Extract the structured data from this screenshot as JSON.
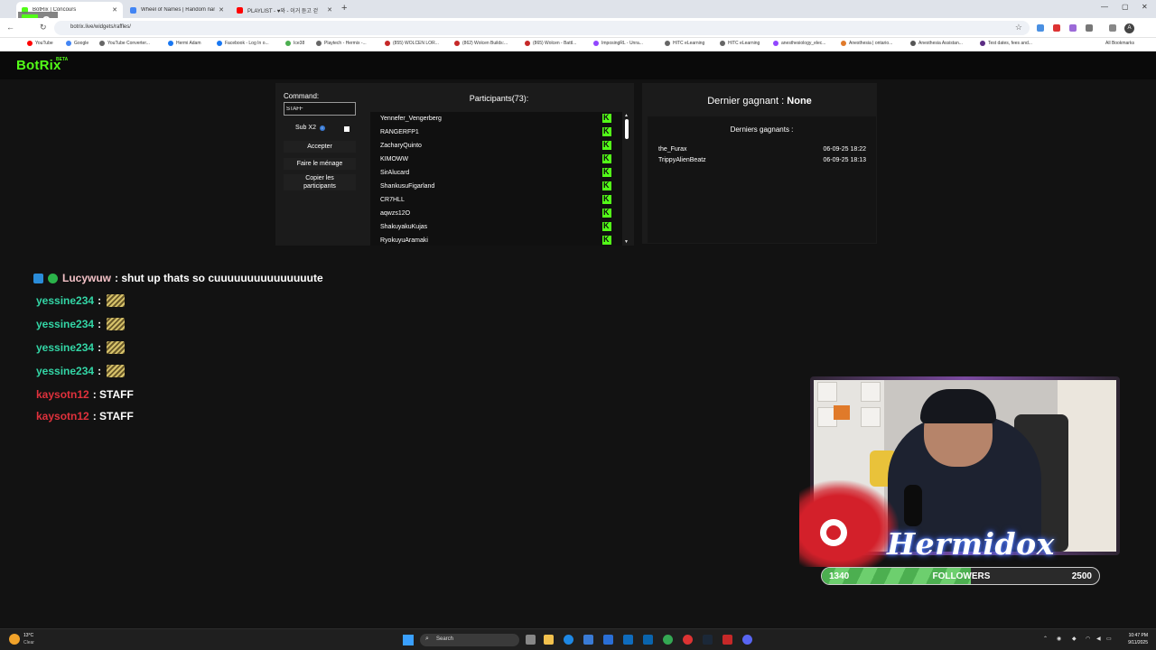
{
  "browser": {
    "tabs": [
      {
        "title": "BotRix | Concours",
        "active": true,
        "favicon_color": "#53fc18"
      },
      {
        "title": "Wheel of Names | Random nam",
        "active": false,
        "favicon_color": "#4285f4"
      },
      {
        "title": "PLAYLIST - ♥와 - 이거 듣고 걷",
        "active": false,
        "favicon_color": "#ff0000"
      }
    ],
    "new_tab": "+",
    "url": "botrix.live/widgets/raffles/",
    "bookmarks": [
      "YouTube",
      "Google",
      "YouTube Converter...",
      "Hermi Adam",
      "Facebook - Log In o...",
      "Ice38",
      "Playtech - Hermix -...",
      "(855) WOLCEN LOR...",
      "(862) Wolcen Builds:...",
      "(865) Wolcen - Battl...",
      "ImposingRL - Unra...",
      "HITC eLearning",
      "HITC eLearning",
      "anesthesiology_elec...",
      "Anesthesia | ontario...",
      "Anesthesia Assistan...",
      "Test dates, fees and..."
    ],
    "all_bookmarks": "All Bookmarks",
    "profile_initial": "A"
  },
  "overlay": {
    "counter": "9"
  },
  "app": {
    "logo": "BotRix",
    "beta": "BETA",
    "command_label": "Command:",
    "command_value": "STAFF",
    "sub_label": "Sub X2",
    "buttons": {
      "accept": "Accepter",
      "clean": "Faire le ménage",
      "copy": "Copier les participants"
    },
    "participants_title": "Participants(73):",
    "participants": [
      "Yennefer_Vengerberg",
      "RANGERFP1",
      "ZacharyQuinto",
      "KIMOWW",
      "SirAlucard",
      "ShankusuFigarland",
      "CR7HLL",
      "aqwzs12O",
      "ShakuyakuKujas",
      "RyokuyuAramaki"
    ],
    "last_winner_label": "Dernier gagnant :",
    "last_winner_value": "None",
    "recent_winners_title": "Derniers gagnants :",
    "recent_winners": [
      {
        "name": "the_Furax",
        "date": "06-09-25 18:22"
      },
      {
        "name": "TrippyAlienBeatz",
        "date": "06-09-25 18:13"
      }
    ]
  },
  "chat": [
    {
      "user": "Lucywuw",
      "color": "#f3c1c6",
      "text": ": shut up thats so cuuuuuuuuuuuuuuute",
      "emote": false,
      "badges": true
    },
    {
      "user": "yessine234",
      "color": "#33d6a6",
      "text": ":",
      "emote": true,
      "badges": false
    },
    {
      "user": "yessine234",
      "color": "#33d6a6",
      "text": ":",
      "emote": true,
      "badges": false
    },
    {
      "user": "yessine234",
      "color": "#33d6a6",
      "text": ":",
      "emote": true,
      "badges": false
    },
    {
      "user": "yessine234",
      "color": "#33d6a6",
      "text": ":",
      "emote": true,
      "badges": false
    },
    {
      "user": "kaysotn12",
      "color": "#e0313c",
      "text": ": STAFF",
      "emote": false,
      "badges": false
    },
    {
      "user": "kaysotn12",
      "color": "#e0313c",
      "text": ": STAFF",
      "emote": false,
      "badges": false
    }
  ],
  "stream": {
    "name": "Hermidox",
    "followers_current": "1340",
    "followers_label": "FOLLOWERS",
    "followers_goal": "2500",
    "followers_progress": 0.536
  },
  "taskbar": {
    "temp": "13°C",
    "weather": "Clear",
    "search_placeholder": "Search",
    "time": "10:47 PM",
    "date": "9/11/2025"
  },
  "colors": {
    "kick_green": "#53fc18",
    "panel": "#1b1b1b",
    "background": "#121212"
  }
}
